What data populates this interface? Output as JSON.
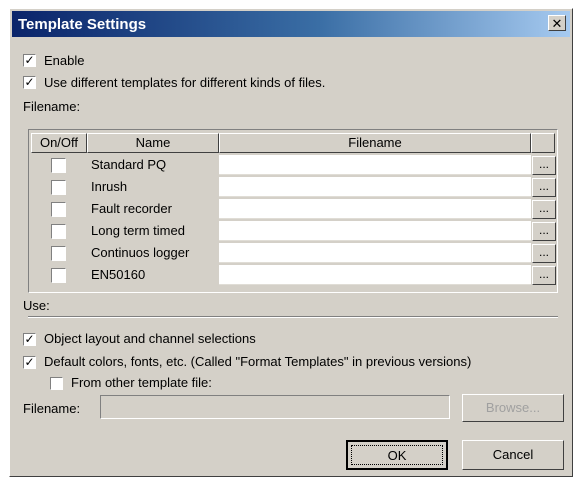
{
  "window": {
    "title": "Template Settings",
    "close_glyph": "✕"
  },
  "options": {
    "enable_label": "Enable",
    "enable_checked": true,
    "different_templates_label": "Use different templates for different kinds of files.",
    "different_templates_checked": true
  },
  "filename_section_label": "Filename:",
  "grid": {
    "headers": {
      "onoff": "On/Off",
      "name": "Name",
      "filename": "Filename",
      "extra": ""
    },
    "browse_glyph": "...",
    "rows": [
      {
        "name": "Standard PQ",
        "checked": false,
        "filename": ""
      },
      {
        "name": "Inrush",
        "checked": false,
        "filename": ""
      },
      {
        "name": "Fault recorder",
        "checked": false,
        "filename": ""
      },
      {
        "name": "Long term timed",
        "checked": false,
        "filename": ""
      },
      {
        "name": "Continuos logger",
        "checked": false,
        "filename": ""
      },
      {
        "name": "EN50160",
        "checked": false,
        "filename": ""
      }
    ]
  },
  "use_section": {
    "label": "Use:",
    "object_layout_label": "Object layout and channel selections",
    "object_layout_checked": true,
    "default_colors_label": "Default colors, fonts, etc. (Called \"Format Templates\" in previous versions)",
    "default_colors_checked": true,
    "other_template_label": "From other template file:",
    "other_template_checked": false
  },
  "filename_field": {
    "label": "Filename:",
    "value": "",
    "browse_label": "Browse..."
  },
  "buttons": {
    "ok": "OK",
    "cancel": "Cancel"
  },
  "check_glyph": "✓"
}
